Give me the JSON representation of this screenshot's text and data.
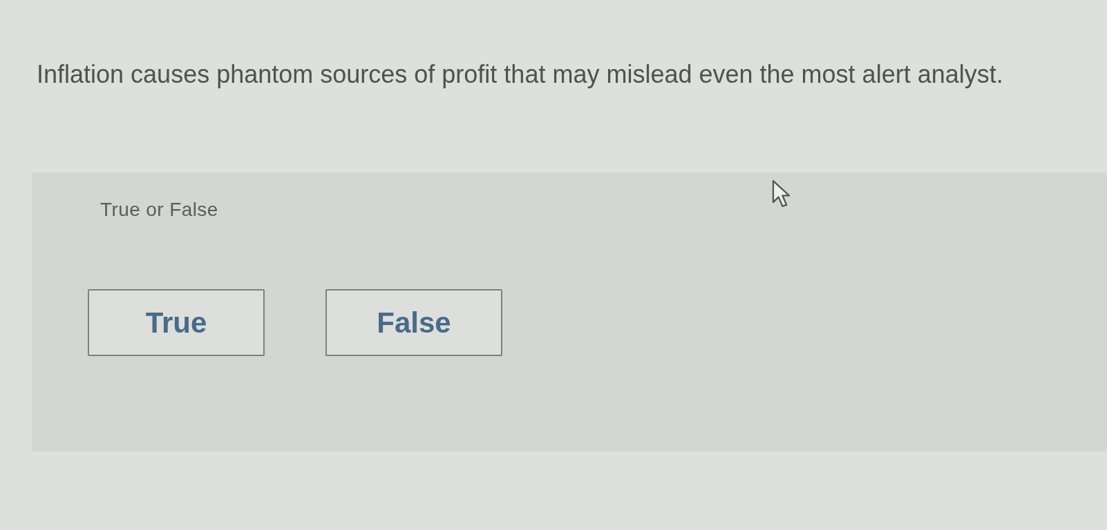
{
  "question": {
    "text": "Inflation causes phantom sources of profit that may mislead even the most alert analyst."
  },
  "answer_panel": {
    "prompt": "True or False",
    "options": [
      {
        "label": "True",
        "selected": false
      },
      {
        "label": "False",
        "selected": false
      }
    ]
  }
}
